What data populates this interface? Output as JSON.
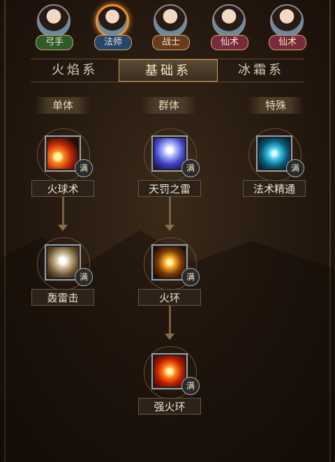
{
  "heroes": [
    {
      "label": "弓手",
      "tag": "green",
      "selected": false
    },
    {
      "label": "法师",
      "tag": "blue",
      "selected": true
    },
    {
      "label": "战士",
      "tag": "brown",
      "selected": false
    },
    {
      "label": "仙术",
      "tag": "red",
      "selected": false
    },
    {
      "label": "仙术",
      "tag": "red",
      "selected": false
    }
  ],
  "tabs": [
    {
      "label": "火焰系",
      "active": false
    },
    {
      "label": "基础系",
      "active": true
    },
    {
      "label": "冰霜系",
      "active": false
    }
  ],
  "columns": [
    "单体",
    "群体",
    "特殊"
  ],
  "skills": [
    {
      "name": "火球术",
      "badge": "满",
      "icon": "fireball-icon"
    },
    {
      "name": "天罚之雷",
      "badge": "满",
      "icon": "thunder-icon"
    },
    {
      "name": "法术精通",
      "badge": "满",
      "icon": "arcane-mastery-icon"
    },
    {
      "name": "轰雷击",
      "badge": "满",
      "icon": "lightning-strike-icon"
    },
    {
      "name": "火环",
      "badge": "满",
      "icon": "fire-ring-icon"
    },
    {
      "name": "强火环",
      "badge": "满",
      "icon": "greater-fire-ring-icon"
    }
  ]
}
